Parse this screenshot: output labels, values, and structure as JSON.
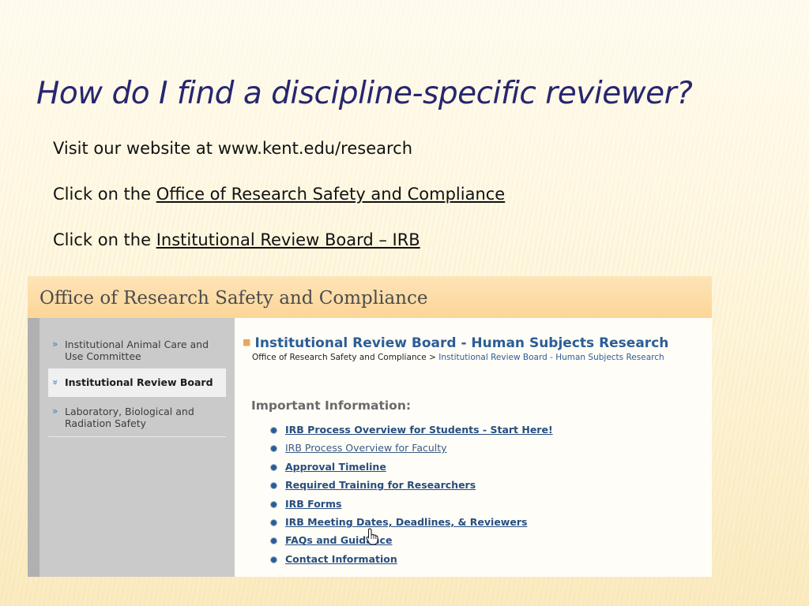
{
  "slide": {
    "title": "How do I find a discipline-specific reviewer?",
    "line1": "Visit our website at www.kent.edu/research",
    "line2_prefix": "Click on the ",
    "line2_link": "Office of Research Safety and Compliance",
    "line3_prefix": "Click on the ",
    "line3_link": "Institutional Review Board – IRB"
  },
  "screenshot": {
    "header_title": "Office of Research Safety and Compliance",
    "sidebar": {
      "items": [
        {
          "label": "Institutional Animal Care and Use Committee",
          "chevron": "»"
        },
        {
          "label": "Institutional Review Board",
          "chevron": "»"
        },
        {
          "label": "Laboratory, Biological and Radiation Safety",
          "chevron": "»"
        }
      ]
    },
    "main": {
      "title": "Institutional Review Board - Human Subjects Research",
      "breadcrumb": {
        "parent": "Office of Research Safety and Compliance",
        "separator": " > ",
        "current": "Institutional Review Board - Human Subjects Research"
      },
      "info_heading": "Important Information:",
      "links": [
        "IRB Process Overview for Students - Start Here!",
        "IRB Process Overview for Faculty",
        "Approval Timeline",
        "Required Training for Researchers",
        "IRB Forms",
        "IRB Meeting Dates, Deadlines, & Reviewers",
        "FAQs and Guidance",
        "Contact Information"
      ]
    }
  },
  "colors": {
    "title": "#27266f",
    "link": "#274e80",
    "header_band": "#fdd597",
    "sidebar": "#cacaca"
  },
  "icons": {
    "cursor": "hand-pointer-icon",
    "bullet": "circle-bullet-icon",
    "sidebar_chevron": "chevron-right-icon"
  }
}
